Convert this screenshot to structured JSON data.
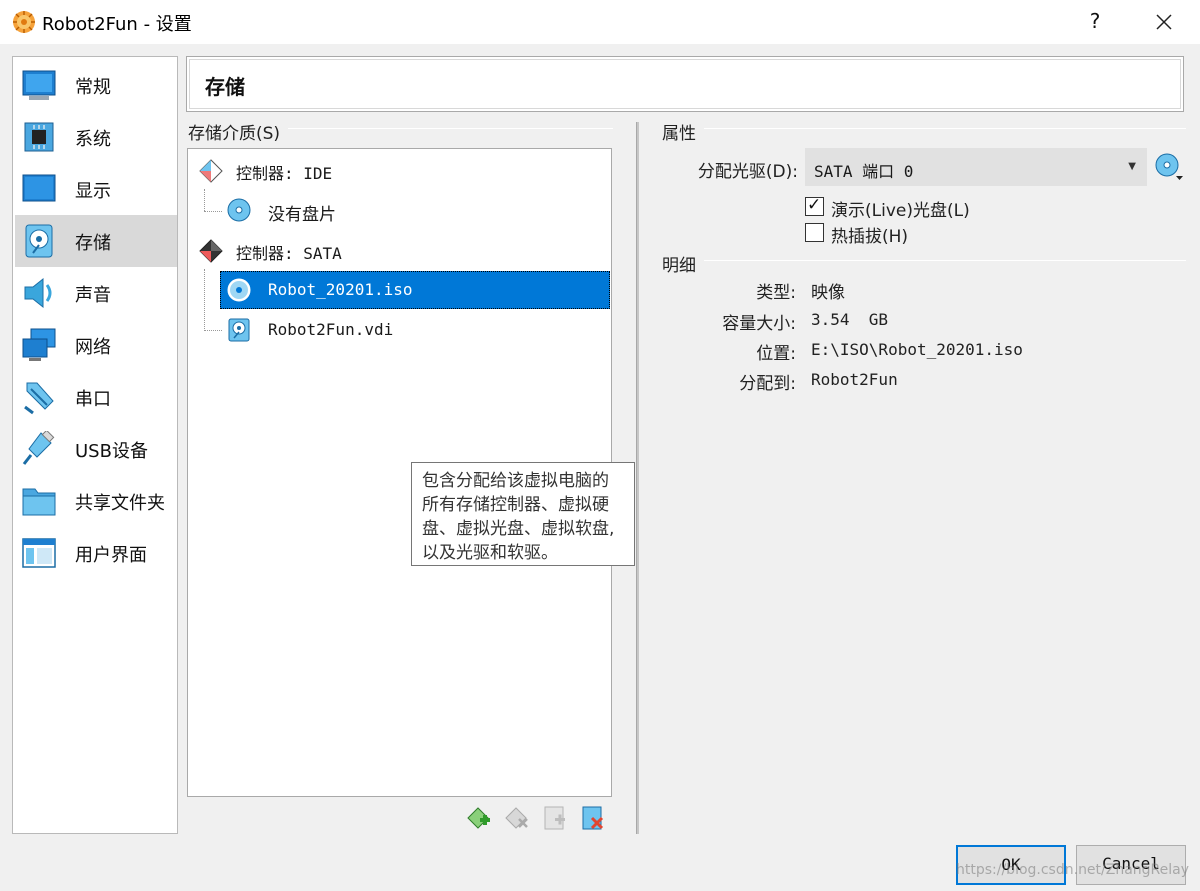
{
  "window": {
    "title": "Robot2Fun - 设置",
    "help_label": "?"
  },
  "sidebar": {
    "items": [
      {
        "label": "常规",
        "icon": "general-monitor-icon"
      },
      {
        "label": "系统",
        "icon": "chip-icon"
      },
      {
        "label": "显示",
        "icon": "display-icon"
      },
      {
        "label": "存储",
        "icon": "storage-disk-icon",
        "selected": true
      },
      {
        "label": "声音",
        "icon": "speaker-icon"
      },
      {
        "label": "网络",
        "icon": "network-icon"
      },
      {
        "label": "串口",
        "icon": "serial-port-icon"
      },
      {
        "label": "USB设备",
        "icon": "usb-icon"
      },
      {
        "label": "共享文件夹",
        "icon": "folder-icon"
      },
      {
        "label": "用户界面",
        "icon": "user-interface-icon"
      }
    ]
  },
  "page": {
    "title": "存储"
  },
  "storage": {
    "heading": "存储介质(S)",
    "tree": {
      "ide_controller": "控制器: IDE",
      "ide_empty_disc": "没有盘片",
      "sata_controller": "控制器: SATA",
      "sata_iso": "Robot_20201.iso",
      "sata_vdi": "Robot2Fun.vdi"
    },
    "tooltip": "包含分配给该虚拟电脑的所有存储控制器、虚拟硬盘、虚拟光盘、虚拟软盘,以及光驱和软驱。"
  },
  "attributes": {
    "heading": "属性",
    "drive_label": "分配光驱(D):",
    "drive_value": "SATA 端口 0",
    "live_cd_label": "演示(Live)光盘(L)",
    "live_cd_checked": true,
    "hotplug_label": "热插拔(H)",
    "hotplug_checked": false
  },
  "details": {
    "heading": "明细",
    "type_label": "类型:",
    "type_value": "映像",
    "size_label": "容量大小:",
    "size_value": "3.54  GB",
    "location_label": "位置:",
    "location_value": "E:\\ISO\\Robot_20201.iso",
    "attached_label": "分配到:",
    "attached_value": "Robot2Fun"
  },
  "buttons": {
    "ok": "OK",
    "cancel": "Cancel"
  },
  "watermark": "https://blog.csdn.net/ZhangRelay",
  "colors": {
    "selection": "#0078d7",
    "disc": "#3aa6dc"
  }
}
